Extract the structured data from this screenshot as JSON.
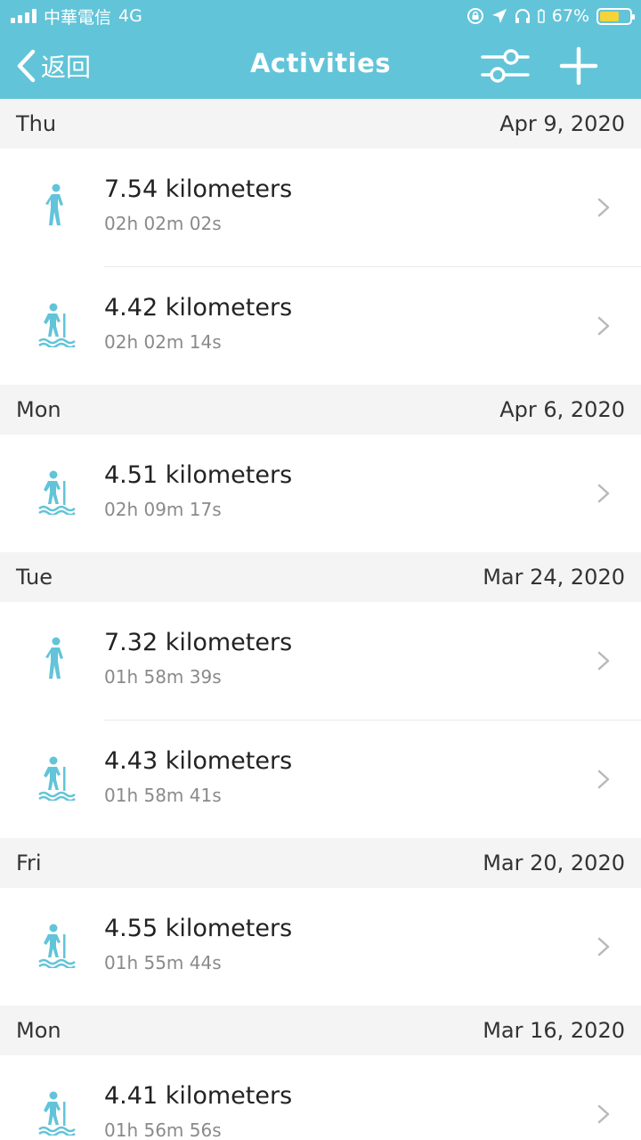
{
  "status_bar": {
    "carrier": "中華電信",
    "network": "4G",
    "battery_percent": "67%",
    "battery_level": 0.67,
    "battery_color": "#f5d33b",
    "icons": [
      "signal-icon",
      "rotation-lock-icon",
      "location-arrow-icon",
      "headphones-icon",
      "battery-icon"
    ]
  },
  "nav": {
    "back_label": "返回",
    "title": "Activities",
    "filter_icon": "sliders-icon",
    "add_icon": "plus-icon"
  },
  "colors": {
    "accent": "#62c4d8",
    "section_bg": "#f4f4f4",
    "secondary_text": "#8a8a8a",
    "chevron": "#b9b9b9"
  },
  "days": [
    {
      "weekday": "Thu",
      "date": "Apr 9, 2020",
      "activities": [
        {
          "type": "walk",
          "icon": "walking-icon",
          "distance": "7.54 kilometers",
          "duration": "02h 02m 02s"
        },
        {
          "type": "hike",
          "icon": "hiking-icon",
          "distance": "4.42 kilometers",
          "duration": "02h 02m 14s"
        }
      ]
    },
    {
      "weekday": "Mon",
      "date": "Apr 6, 2020",
      "activities": [
        {
          "type": "hike",
          "icon": "hiking-icon",
          "distance": "4.51 kilometers",
          "duration": "02h 09m 17s"
        }
      ]
    },
    {
      "weekday": "Tue",
      "date": "Mar 24, 2020",
      "activities": [
        {
          "type": "walk",
          "icon": "walking-icon",
          "distance": "7.32 kilometers",
          "duration": "01h 58m 39s"
        },
        {
          "type": "hike",
          "icon": "hiking-icon",
          "distance": "4.43 kilometers",
          "duration": "01h 58m 41s"
        }
      ]
    },
    {
      "weekday": "Fri",
      "date": "Mar 20, 2020",
      "activities": [
        {
          "type": "hike",
          "icon": "hiking-icon",
          "distance": "4.55 kilometers",
          "duration": "01h 55m 44s"
        }
      ]
    },
    {
      "weekday": "Mon",
      "date": "Mar 16, 2020",
      "activities": [
        {
          "type": "hike",
          "icon": "hiking-icon",
          "distance": "4.41 kilometers",
          "duration": "01h 56m 56s"
        }
      ]
    }
  ]
}
